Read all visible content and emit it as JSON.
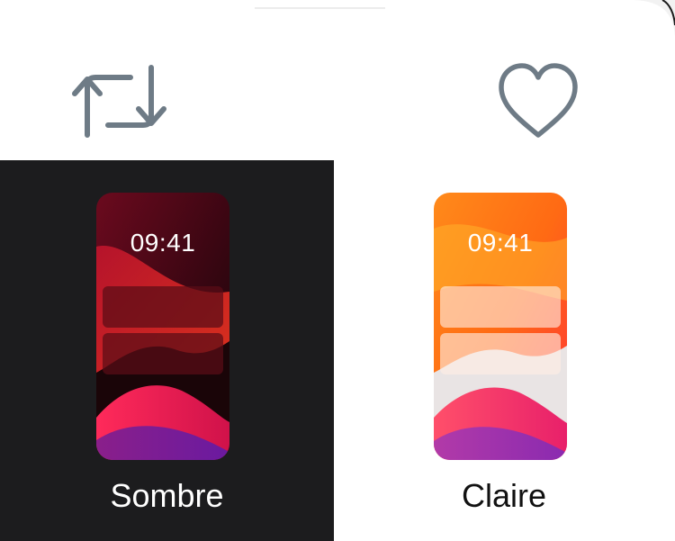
{
  "actions": {
    "retweet_icon": "retweet-icon",
    "like_icon": "heart-icon",
    "icon_color": "#6e7b86"
  },
  "appearance": {
    "options": [
      {
        "label": "Sombre",
        "time": "09:41",
        "selected": true,
        "background": "#1c1c1e"
      },
      {
        "label": "Claire",
        "time": "09:41",
        "selected": false,
        "background": "#ffffff"
      }
    ]
  }
}
